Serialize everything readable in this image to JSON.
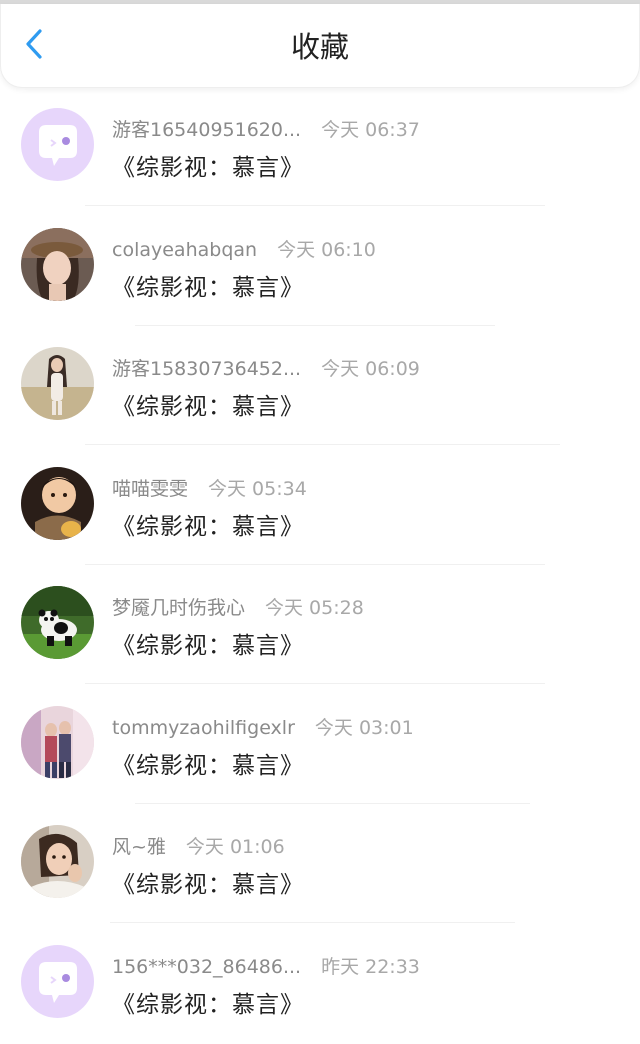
{
  "header": {
    "title": "收藏",
    "back_icon": "chevron-left-icon",
    "accent_color": "#2f9bf0"
  },
  "items": [
    {
      "user": "游客16540951620...",
      "time": "今天 06:37",
      "content": "《综影视：慕言》",
      "avatar": "default-chat-avatar"
    },
    {
      "user": "colayeahabqan",
      "time": "今天 06:10",
      "content": "《综影视：慕言》",
      "avatar": "photo-woman-hat"
    },
    {
      "user": "游客15830736452...",
      "time": "今天 06:09",
      "content": "《综影视：慕言》",
      "avatar": "photo-girl-field"
    },
    {
      "user": "喵喵雯雯",
      "time": "今天 05:34",
      "content": "《综影视：慕言》",
      "avatar": "photo-baby"
    },
    {
      "user": "梦魇几时伤我心",
      "time": "今天 05:28",
      "content": "《综影视：慕言》",
      "avatar": "photo-panda"
    },
    {
      "user": "tommyzaohilfigexlr",
      "time": "今天 03:01",
      "content": "《综影视：慕言》",
      "avatar": "photo-couple-street"
    },
    {
      "user": "风~雅",
      "time": "今天 01:06",
      "content": "《综影视：慕言》",
      "avatar": "photo-woman-portrait"
    },
    {
      "user": "156***032_86486...",
      "time": "昨天 22:33",
      "content": "《综影视：慕言》",
      "avatar": "default-chat-avatar"
    }
  ]
}
